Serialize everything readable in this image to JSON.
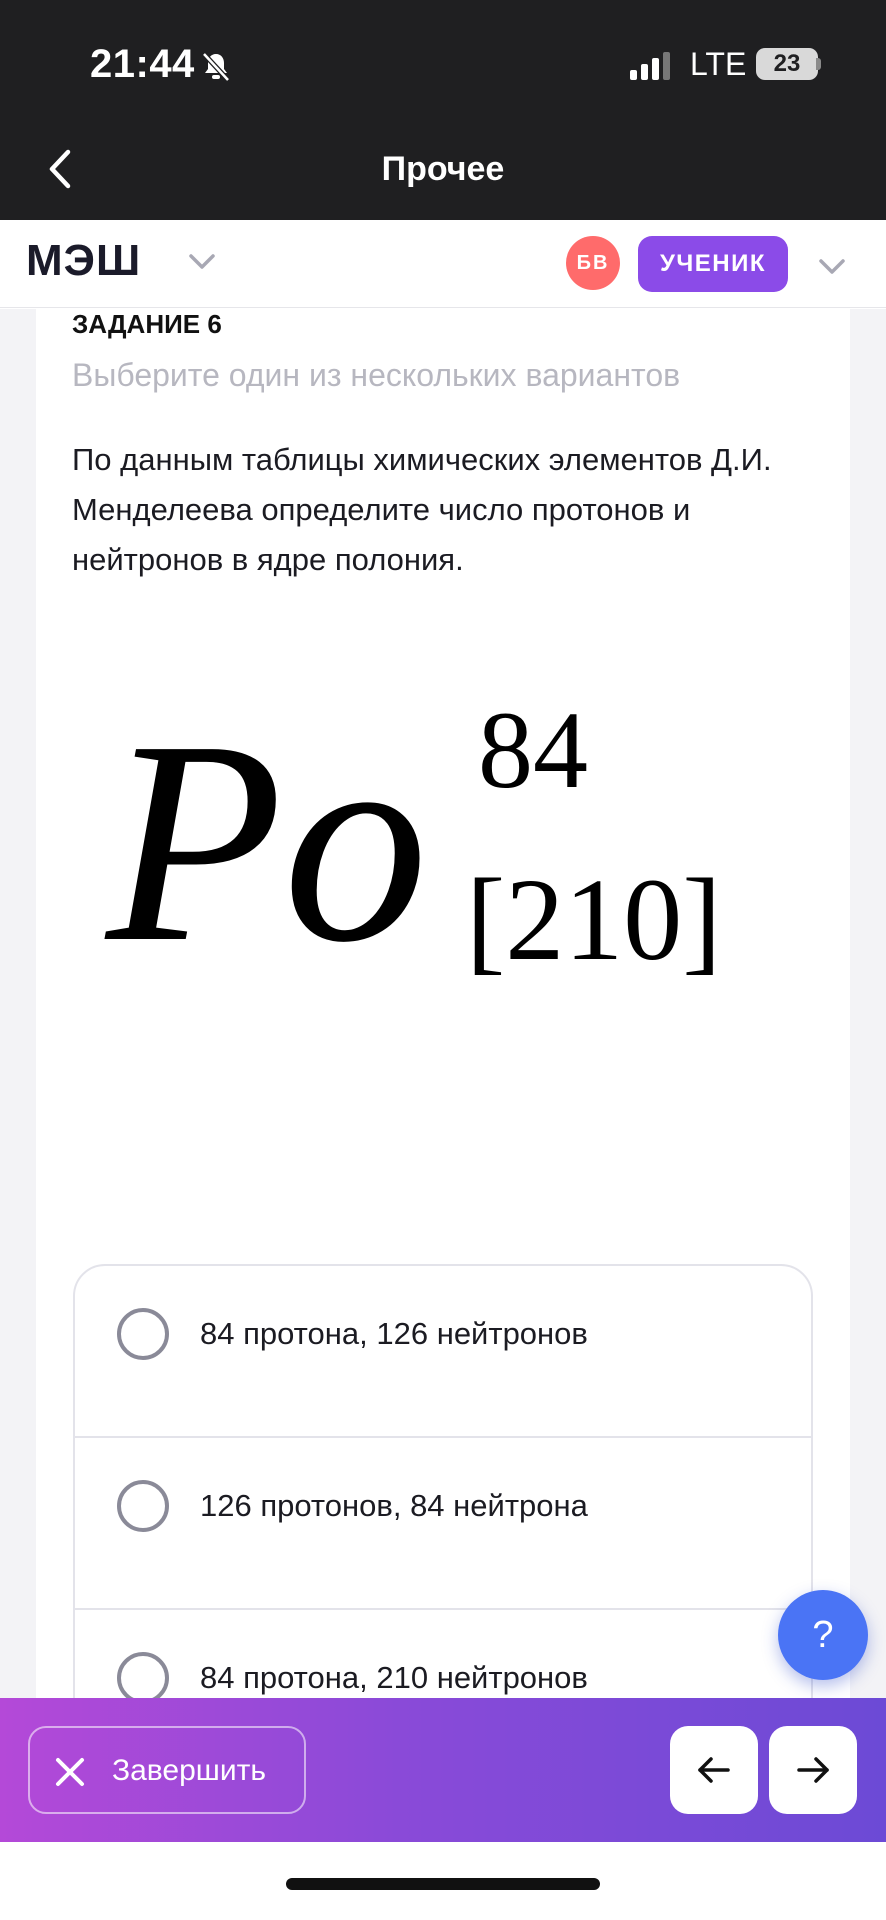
{
  "status_bar": {
    "time": "21:44",
    "network": "LTE",
    "battery": "23"
  },
  "nav": {
    "title": "Прочее"
  },
  "app_header": {
    "logo": "МЭШ",
    "avatar_initials": "БВ",
    "role": "УЧЕНИК",
    "accent": "#8b4be8"
  },
  "task": {
    "number_label": "ЗАДАНИЕ 6",
    "instruction": "Выберите один из нескольких вариантов",
    "question": "По данным таблицы химических элементов Д.И. Менделеева определите число протонов и нейтронов в ядре полония.",
    "formula": {
      "symbol": "Po",
      "superscript": "84",
      "subscript": "[210]"
    }
  },
  "options": [
    {
      "label": "84 протона, 126 нейтронов",
      "selected": false
    },
    {
      "label": "126 протонов, 84 нейтрона",
      "selected": false
    },
    {
      "label": "84 протона, 210 нейтронов",
      "selected": false
    }
  ],
  "help": {
    "label": "?"
  },
  "bottom_bar": {
    "finish_label": "Завершить"
  }
}
